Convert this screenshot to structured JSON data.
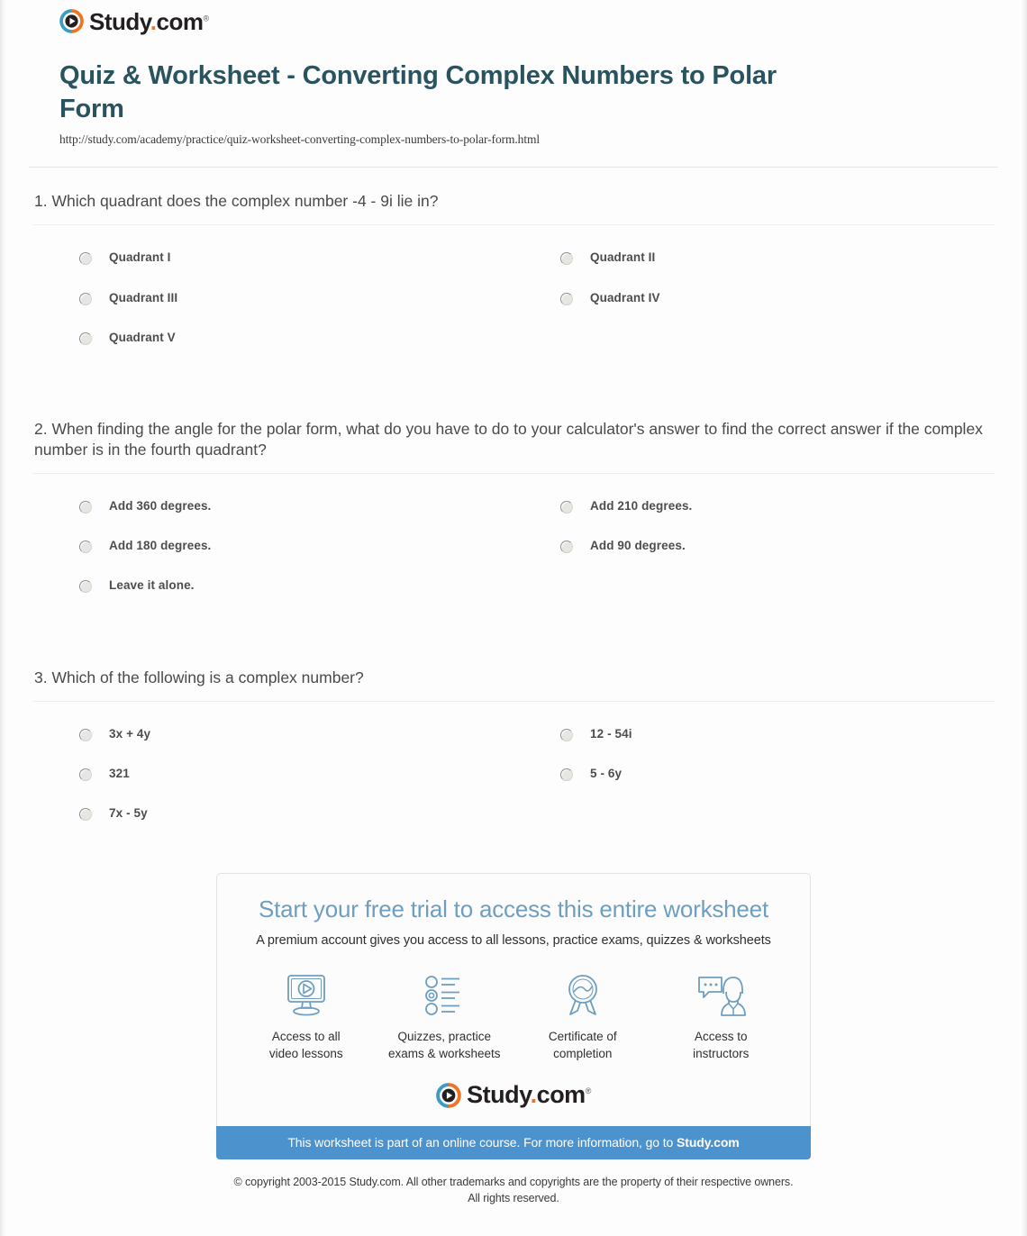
{
  "brand": {
    "name_main": "Study",
    "name_dot": ".",
    "name_tld": "com",
    "trademark": "®",
    "play_icon": "play-circle-icon",
    "color_orange": "#ee7523",
    "color_blue": "#3d9bc4",
    "color_dark": "#231f20"
  },
  "header": {
    "title": "Quiz & Worksheet - Converting Complex Numbers to Polar Form",
    "url": "http://study.com/academy/practice/quiz-worksheet-converting-complex-numbers-to-polar-form.html",
    "title_color": "#2a5360"
  },
  "questions": [
    {
      "number": "1.",
      "text": "1. Which quadrant does the complex number -4 - 9i lie in?",
      "options": [
        "Quadrant I",
        "Quadrant II",
        "Quadrant III",
        "Quadrant IV",
        "Quadrant V"
      ]
    },
    {
      "number": "2.",
      "text": "2. When finding the angle for the polar form, what do you have to do to your calculator's answer to find the correct answer if the complex number is in the fourth quadrant?",
      "options": [
        "Add 360 degrees.",
        "Add 210 degrees.",
        "Add 180 degrees.",
        "Add 90 degrees.",
        "Leave it alone."
      ]
    },
    {
      "number": "3.",
      "text": "3. Which of the following is a complex number?",
      "options": [
        "3x + 4y",
        "12 - 54i",
        "321",
        "5 - 6y",
        "7x - 5y"
      ]
    }
  ],
  "promo": {
    "headline": "Start your free trial to access this entire worksheet",
    "subhead": "A premium account gives you access to all lessons, practice exams, quizzes & worksheets",
    "headline_color": "#6e9ec0",
    "features": [
      {
        "icon": "monitor-play-icon",
        "label": "Access to all\nvideo lessons"
      },
      {
        "icon": "quiz-list-icon",
        "label": "Quizzes, practice\nexams & worksheets"
      },
      {
        "icon": "award-ribbon-icon",
        "label": "Certificate of\ncompletion"
      },
      {
        "icon": "instructor-chat-icon",
        "label": "Access to\ninstructors"
      }
    ],
    "banner_text": "This worksheet is part of an online course. For more information, go to ",
    "banner_link": "Study.com",
    "banner_color": "#4c92cc"
  },
  "footer": {
    "copyright_line1": "© copyright 2003-2015 Study.com. All other trademarks and copyrights are the property of their respective owners.",
    "copyright_line2": "All rights reserved."
  }
}
